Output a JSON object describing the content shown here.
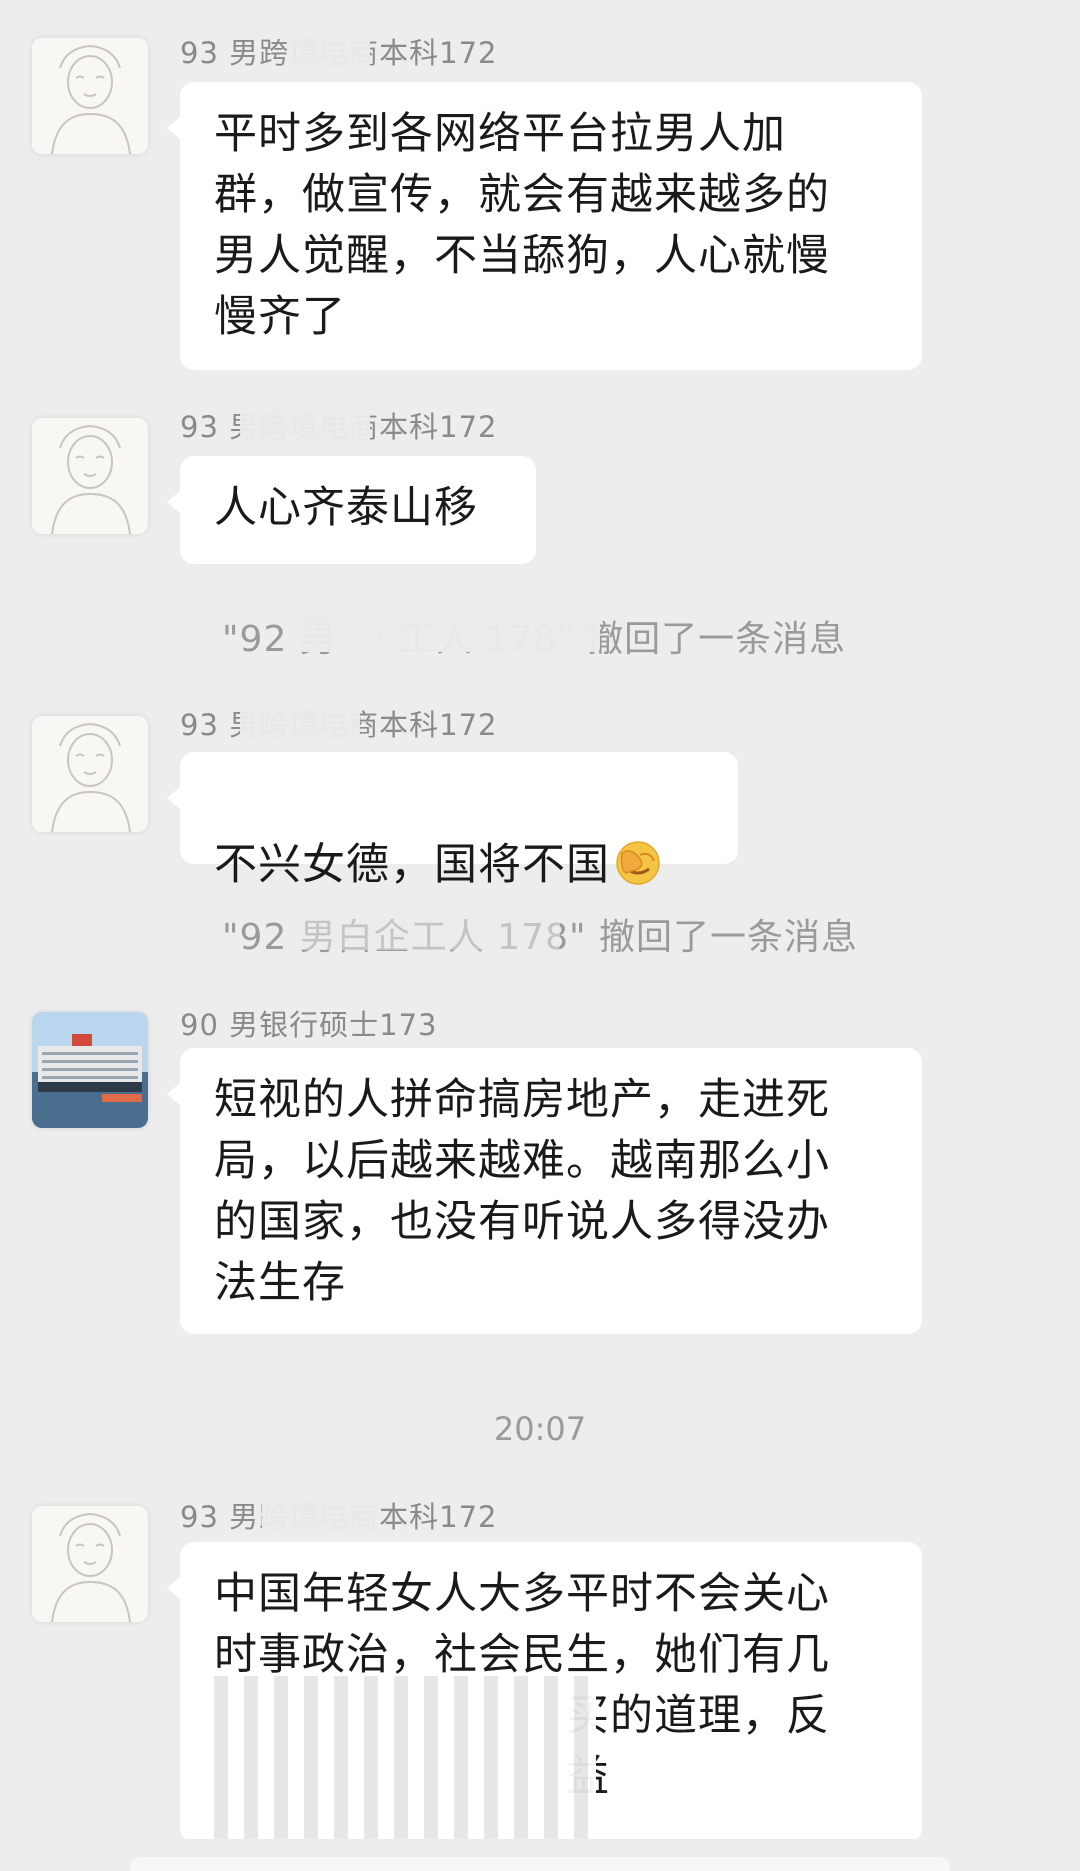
{
  "messages": [
    {
      "sender": "93 男跨境电商本科172",
      "text": "平时多到各网络平台拉男人加\n群，做宣传，就会有越来越多的\n男人觉醒，不当舔狗，人心就慢\n慢齐了"
    },
    {
      "sender": "93 男跨境电商本科172",
      "text": "人心齐泰山移"
    },
    {
      "system": "\"92 男 ··· 工人 178\" 撤回了一条消息"
    },
    {
      "sender": "93 男跨境电商本科172",
      "text": "不兴女德，国将不国",
      "emoji": "face-palm-emoji"
    },
    {
      "system": "\"92 男白企工人 178\" 撤回了一条消息"
    },
    {
      "sender": "90 男银行硕士173",
      "text": "短视的人拼命搞房地产，走进死\n局，以后越来越难。越南那么小\n的国家，也没有听说人多得没办\n法生存"
    },
    {
      "time": "20:07"
    },
    {
      "sender": "93 男跨境电商本科172",
      "text": "中国年轻女人大多平时不会关心\n时事政治，社会民生，她们有几\n　　　　　　　　买的道理，反\n　　　　　　　　益"
    }
  ]
}
